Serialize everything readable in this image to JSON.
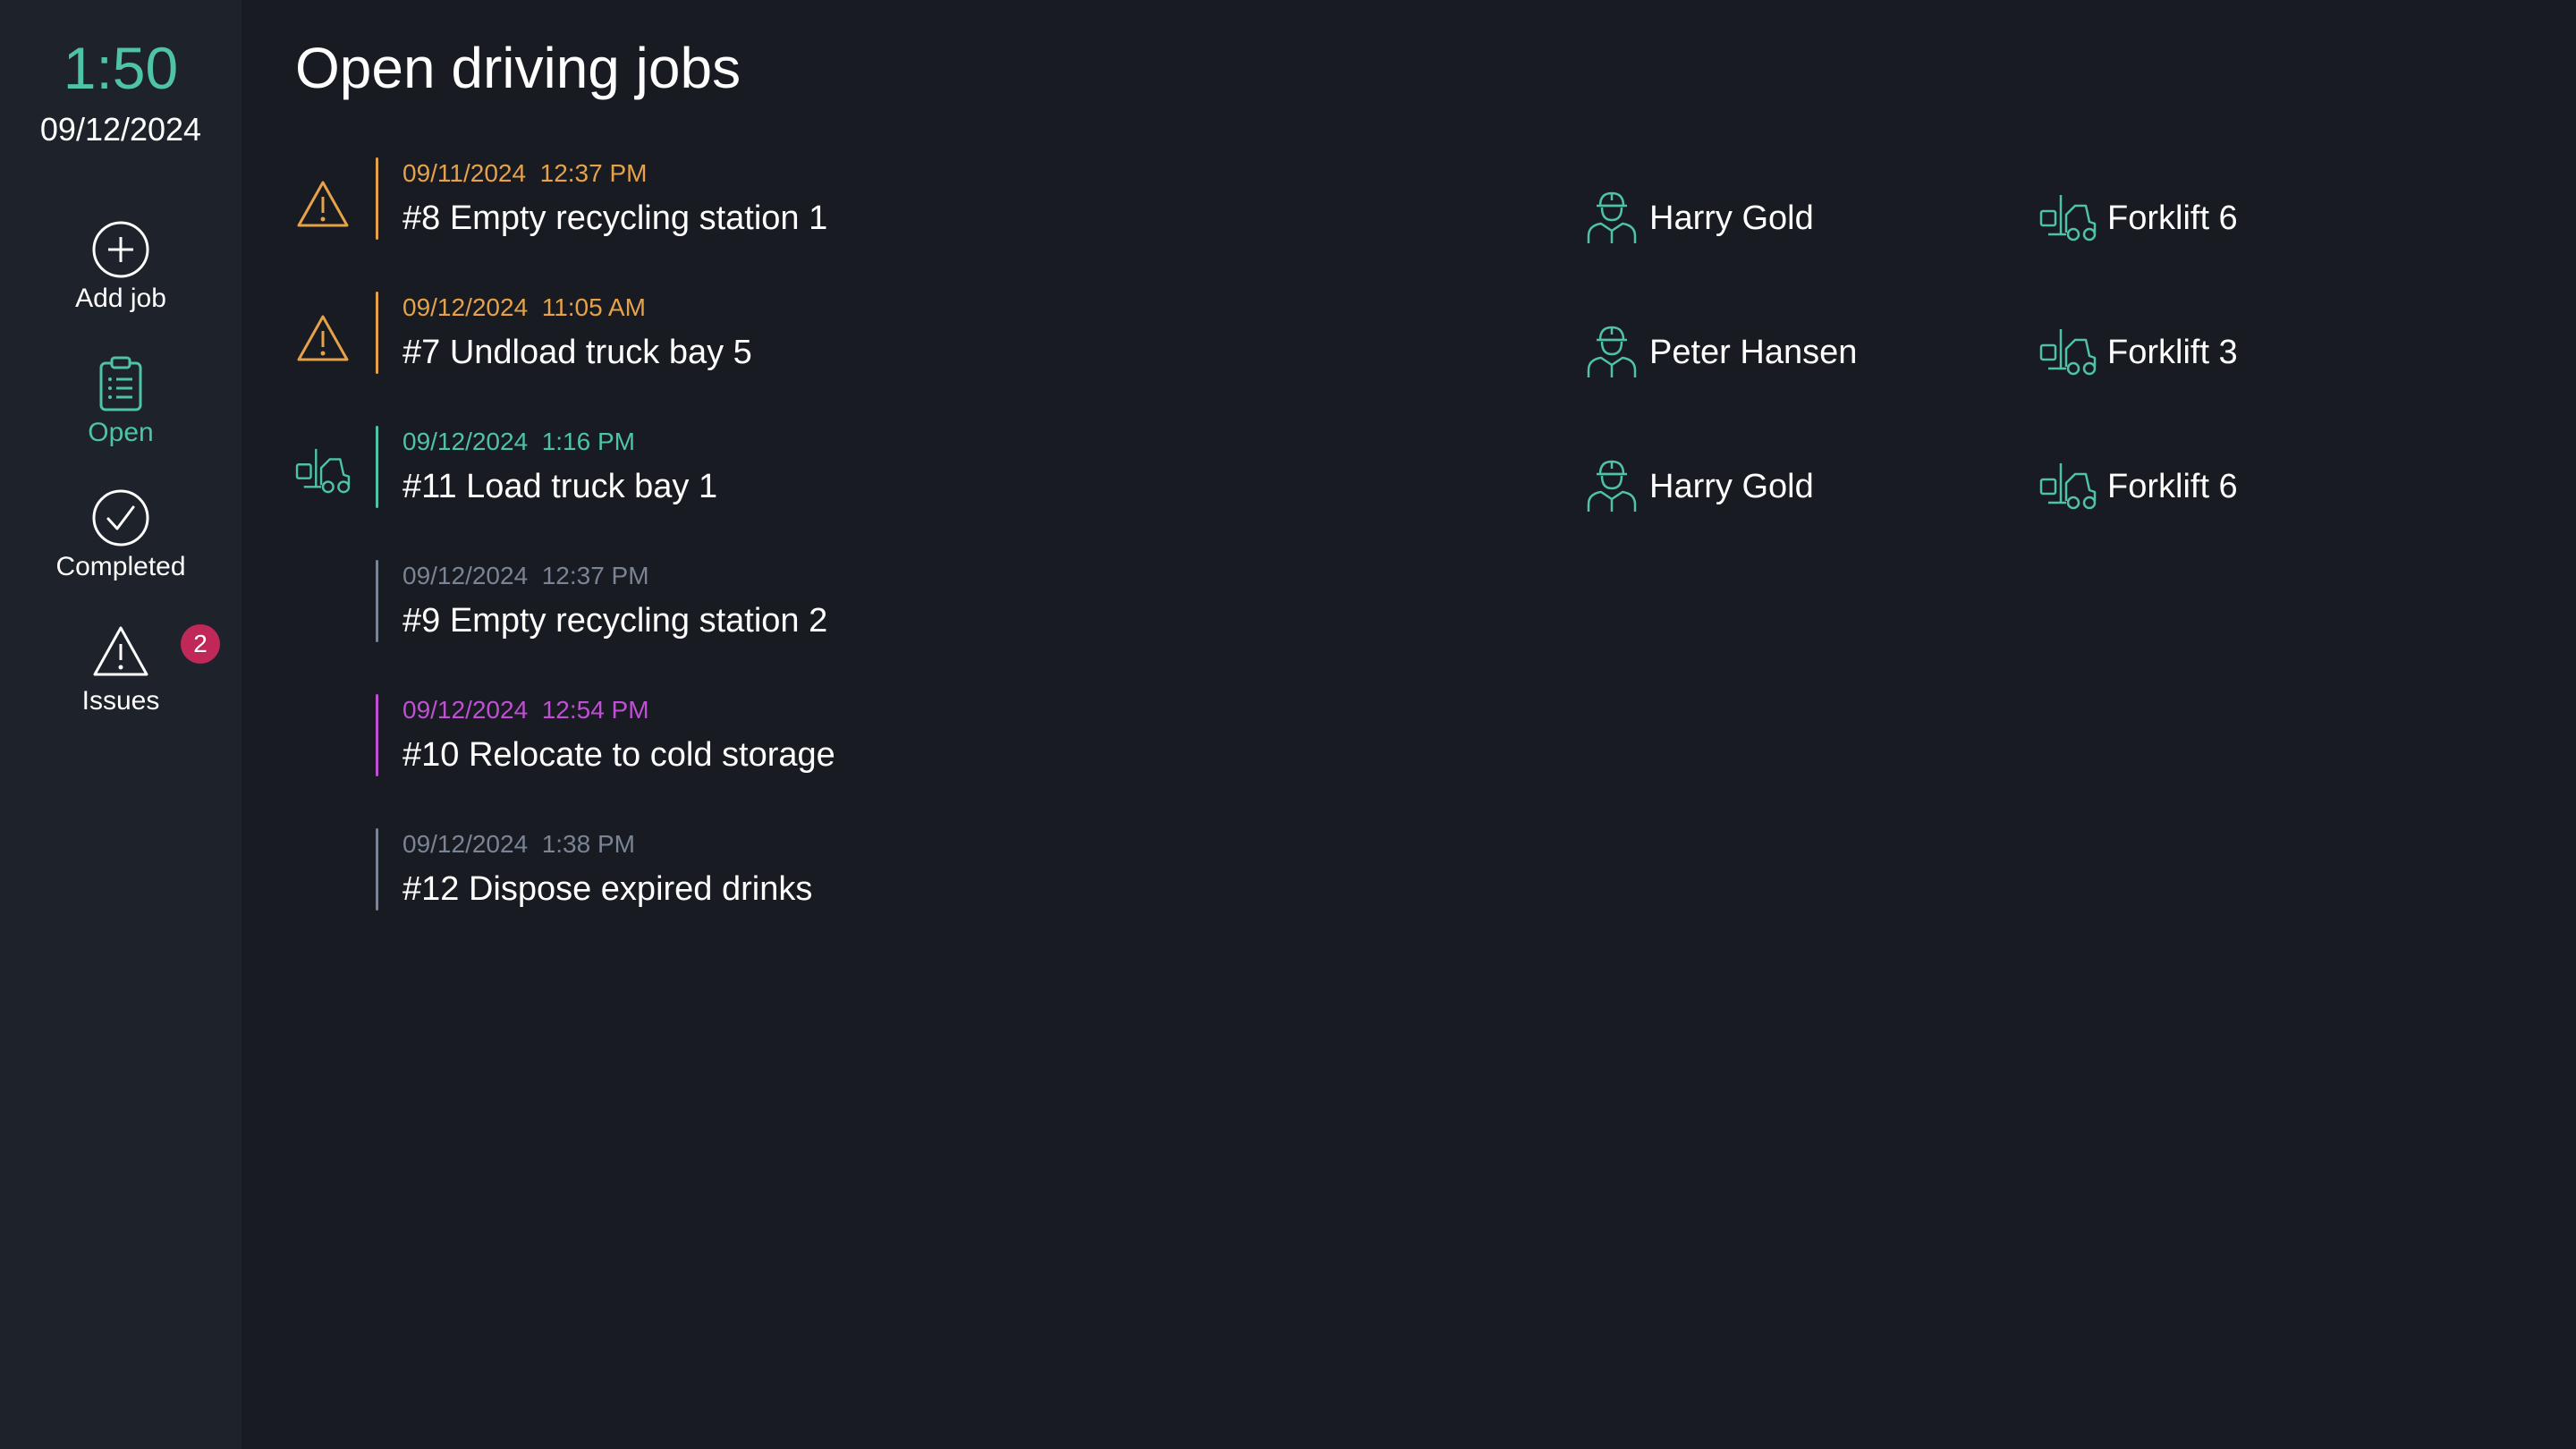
{
  "sidebar": {
    "time": "1:50",
    "date": "09/12/2024",
    "items": [
      {
        "label": "Add job",
        "icon": "plus-circle-icon"
      },
      {
        "label": "Open",
        "icon": "clipboard-list-icon",
        "active": true
      },
      {
        "label": "Completed",
        "icon": "check-circle-icon"
      },
      {
        "label": "Issues",
        "icon": "warning-icon",
        "badge": "2"
      }
    ]
  },
  "main": {
    "title": "Open driving jobs",
    "jobs": [
      {
        "date": "09/11/2024",
        "time": "12:37 PM",
        "title": "#8 Empty recycling station 1",
        "status_icon": "warning-icon",
        "color": "#e5a24a",
        "driver": "Harry Gold",
        "vehicle": "Forklift 6"
      },
      {
        "date": "09/12/2024",
        "time": "11:05 AM",
        "title": "#7 Undload truck bay 5",
        "status_icon": "warning-icon",
        "color": "#e5a24a",
        "driver": "Peter Hansen",
        "vehicle": "Forklift 3"
      },
      {
        "date": "09/12/2024",
        "time": "1:16 PM",
        "title": "#11 Load truck bay 1",
        "status_icon": "forklift-icon",
        "color": "#4fc3a6",
        "driver": "Harry Gold",
        "vehicle": "Forklift 6"
      },
      {
        "date": "09/12/2024",
        "time": "12:37 PM",
        "title": "#9 Empty recycling station 2",
        "color": "#7a8494"
      },
      {
        "date": "09/12/2024",
        "time": "12:54 PM",
        "title": "#10 Relocate to cold storage",
        "color": "#c04fd6"
      },
      {
        "date": "09/12/2024",
        "time": "1:38 PM",
        "title": "#12 Dispose expired drinks",
        "color": "#7a8494"
      }
    ]
  },
  "colors": {
    "accent": "#4fc3a6",
    "warning": "#e5a24a",
    "badge": "#c0285a",
    "background": "#181b21",
    "sidebar": "#1e222a"
  }
}
